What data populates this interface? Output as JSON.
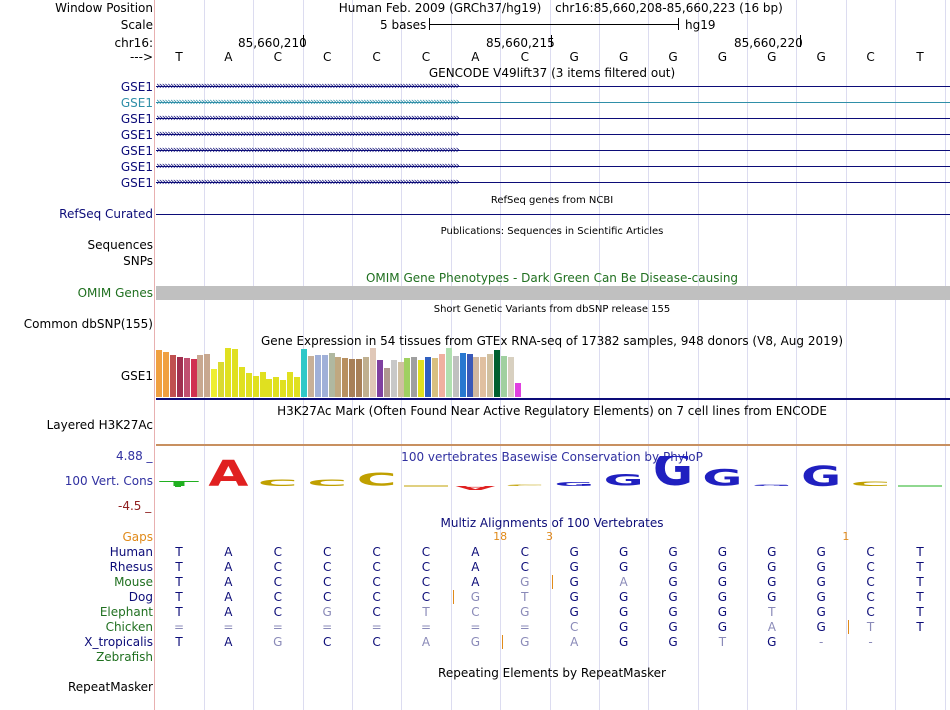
{
  "header": {
    "window_position_label": "Window Position",
    "assembly_text": "Human Feb. 2009 (GRCh37/hg19)",
    "position_text": "chr16:85,660,208-85,660,223 (16 bp)",
    "scale_label": "Scale",
    "scale_text": "5 bases",
    "scale_db": "hg19",
    "chrom_label": "chr16:",
    "coords": [
      "85,660,210",
      "85,660,215",
      "85,660,220"
    ],
    "strand_label": "--->"
  },
  "bases": [
    "T",
    "A",
    "C",
    "C",
    "C",
    "C",
    "A",
    "C",
    "G",
    "G",
    "G",
    "G",
    "G",
    "G",
    "C",
    "T"
  ],
  "gencode": {
    "title": "GENCODE V49lift37 (3 items filtered out)",
    "rows": [
      "GSE1",
      "GSE1",
      "GSE1",
      "GSE1",
      "GSE1",
      "GSE1",
      "GSE1"
    ],
    "highlight_index": 1,
    "color": "#0c0c78",
    "highlight_color": "#2f8fa8"
  },
  "refseq": {
    "label": "RefSeq Curated",
    "title": "RefSeq genes from NCBI"
  },
  "publications": {
    "title": "Publications: Sequences in Scientific Articles",
    "sequences_label": "Sequences",
    "snps_label": "SNPs"
  },
  "omim": {
    "title": "OMIM Gene Phenotypes - Dark Green Can Be Disease-causing",
    "label": "OMIM Genes"
  },
  "dbsnp": {
    "title": "Short Genetic Variants from dbSNP release 155",
    "label": "Common dbSNP(155)"
  },
  "gtex": {
    "title": "Gene Expression in 54 tissues from GTEx RNA-seq of 17382 samples, 948 donors (V8, Aug 2019)",
    "label": "GSE1",
    "bars": [
      {
        "c": "#f0a040",
        "v": 0.95
      },
      {
        "c": "#f0a040",
        "v": 0.92
      },
      {
        "c": "#c05050",
        "v": 0.85
      },
      {
        "c": "#a03050",
        "v": 0.82
      },
      {
        "c": "#c05070",
        "v": 0.8
      },
      {
        "c": "#d03050",
        "v": 0.78
      },
      {
        "c": "#c8a890",
        "v": 0.86
      },
      {
        "c": "#c8a890",
        "v": 0.88
      },
      {
        "c": "#eeee30",
        "v": 0.58
      },
      {
        "c": "#dada30",
        "v": 0.72
      },
      {
        "c": "#e0e020",
        "v": 1.0
      },
      {
        "c": "#e0e020",
        "v": 0.98
      },
      {
        "c": "#e0e020",
        "v": 0.62
      },
      {
        "c": "#e0e020",
        "v": 0.48
      },
      {
        "c": "#e0e020",
        "v": 0.42
      },
      {
        "c": "#e0e020",
        "v": 0.5
      },
      {
        "c": "#e0e020",
        "v": 0.36
      },
      {
        "c": "#e0e020",
        "v": 0.4
      },
      {
        "c": "#e0e020",
        "v": 0.35
      },
      {
        "c": "#e0e020",
        "v": 0.52
      },
      {
        "c": "#e0e020",
        "v": 0.4
      },
      {
        "c": "#30c8c8",
        "v": 0.98
      },
      {
        "c": "#c8b098",
        "v": 0.84
      },
      {
        "c": "#a0b0d8",
        "v": 0.86
      },
      {
        "c": "#a0b0d8",
        "v": 0.86
      },
      {
        "c": "#b0b8a0",
        "v": 0.9
      },
      {
        "c": "#c0a880",
        "v": 0.82
      },
      {
        "c": "#b89060",
        "v": 0.8
      },
      {
        "c": "#a88058",
        "v": 0.78
      },
      {
        "c": "#a88058",
        "v": 0.78
      },
      {
        "c": "#c0b090",
        "v": 0.82
      },
      {
        "c": "#e0c8b8",
        "v": 1.0
      },
      {
        "c": "#8040a0",
        "v": 0.76
      },
      {
        "c": "#b09890",
        "v": 0.6
      },
      {
        "c": "#c8c8c8",
        "v": 0.76
      },
      {
        "c": "#d0c0a0",
        "v": 0.72
      },
      {
        "c": "#a0d060",
        "v": 0.8
      },
      {
        "c": "#a0a0a0",
        "v": 0.82
      },
      {
        "c": "#e0e020",
        "v": 0.76
      },
      {
        "c": "#3060c0",
        "v": 0.82
      },
      {
        "c": "#d8c080",
        "v": 0.8
      },
      {
        "c": "#f0b0a0",
        "v": 0.88
      },
      {
        "c": "#b0e0b0",
        "v": 1.0
      },
      {
        "c": "#c0c0c0",
        "v": 0.84
      },
      {
        "c": "#2878d0",
        "v": 0.9
      },
      {
        "c": "#3858b8",
        "v": 0.88
      },
      {
        "c": "#d0b8a0",
        "v": 0.82
      },
      {
        "c": "#e0c0a0",
        "v": 0.82
      },
      {
        "c": "#d0c0a0",
        "v": 0.88
      },
      {
        "c": "#006030",
        "v": 0.96
      },
      {
        "c": "#a0d0a0",
        "v": 0.84
      },
      {
        "c": "#d8d0c0",
        "v": 0.82
      },
      {
        "c": "#e040e0",
        "v": 0.28
      }
    ]
  },
  "h3k27ac": {
    "title": "H3K27Ac Mark (Often Found Near Active Regulatory Elements) on 7 cell lines from ENCODE",
    "label": "Layered H3K27Ac"
  },
  "phylop": {
    "title": "100 vertebrates Basewise Conservation by PhyloP",
    "label": "100 Vert. Cons",
    "ymax": "4.88 _",
    "ymin": "-4.5 _",
    "heights": [
      0.35,
      1.8,
      0.45,
      0.45,
      0.9,
      0.05,
      -0.25,
      0.1,
      0.25,
      0.8,
      2.3,
      1.1,
      0.1,
      1.4,
      0.3,
      0.0
    ]
  },
  "multiz": {
    "title": "Multiz Alignments of 100 Vertebrates",
    "gaps_label": "Gaps",
    "gap_counts": [
      {
        "i": 6.5,
        "t": "18"
      },
      {
        "i": 7.5,
        "t": "3"
      },
      {
        "i": 13.5,
        "t": "1"
      }
    ],
    "species": [
      {
        "name": "Human",
        "color": "#0c0c78",
        "bases": [
          "T",
          "A",
          "C",
          "C",
          "C",
          "C",
          "A",
          "C",
          "G",
          "G",
          "G",
          "G",
          "G",
          "G",
          "C",
          "T"
        ],
        "dim": [],
        "ins": []
      },
      {
        "name": "Rhesus",
        "color": "#0c0c78",
        "bases": [
          "T",
          "A",
          "C",
          "C",
          "C",
          "C",
          "A",
          "C",
          "G",
          "G",
          "G",
          "G",
          "G",
          "G",
          "C",
          "T"
        ],
        "dim": [],
        "ins": []
      },
      {
        "name": "Mouse",
        "color": "#207020",
        "bases": [
          "T",
          "A",
          "C",
          "C",
          "C",
          "C",
          "A",
          "G",
          "G",
          "A",
          "G",
          "G",
          "G",
          "G",
          "C",
          "T"
        ],
        "dim": [
          7,
          9
        ],
        "ins": [
          7.5
        ]
      },
      {
        "name": "Dog",
        "color": "#0c0c78",
        "bases": [
          "T",
          "A",
          "C",
          "C",
          "C",
          "C",
          "G",
          "T",
          "G",
          "G",
          "G",
          "G",
          "G",
          "G",
          "C",
          "T"
        ],
        "dim": [
          6,
          7
        ],
        "ins": [
          5.5
        ]
      },
      {
        "name": "Elephant",
        "color": "#207020",
        "bases": [
          "T",
          "A",
          "C",
          "G",
          "C",
          "T",
          "C",
          "G",
          "G",
          "G",
          "G",
          "G",
          "T",
          "G",
          "C",
          "T"
        ],
        "dim": [
          3,
          5,
          6,
          7,
          12
        ],
        "ins": []
      },
      {
        "name": "Chicken",
        "color": "#207020",
        "bases": [
          "=",
          "=",
          "=",
          "=",
          "=",
          "=",
          "=",
          "=",
          "C",
          "G",
          "G",
          "G",
          "A",
          "G",
          "T",
          "T"
        ],
        "dim": [
          0,
          1,
          2,
          3,
          4,
          5,
          6,
          7,
          8,
          12,
          14
        ],
        "ins": [
          13.5
        ]
      },
      {
        "name": "X_tropicalis",
        "color": "#0c0c78",
        "bases": [
          "T",
          "A",
          "G",
          "C",
          "C",
          "A",
          "G",
          "G",
          "A",
          "G",
          "G",
          "T",
          "G",
          "-",
          "-",
          ""
        ],
        "dim": [
          2,
          5,
          6,
          7,
          8,
          11,
          13,
          14
        ],
        "ins": [
          6.5
        ]
      },
      {
        "name": "Zebrafish",
        "color": "#207020",
        "bases": [
          "",
          "",
          "",
          "",
          "",
          "",
          "",
          "",
          "",
          "",
          "",
          "",
          "",
          "",
          "",
          ""
        ],
        "dim": [],
        "ins": []
      }
    ]
  },
  "repeatmasker": {
    "title": "Repeating Elements by RepeatMasker",
    "label": "RepeatMasker"
  }
}
